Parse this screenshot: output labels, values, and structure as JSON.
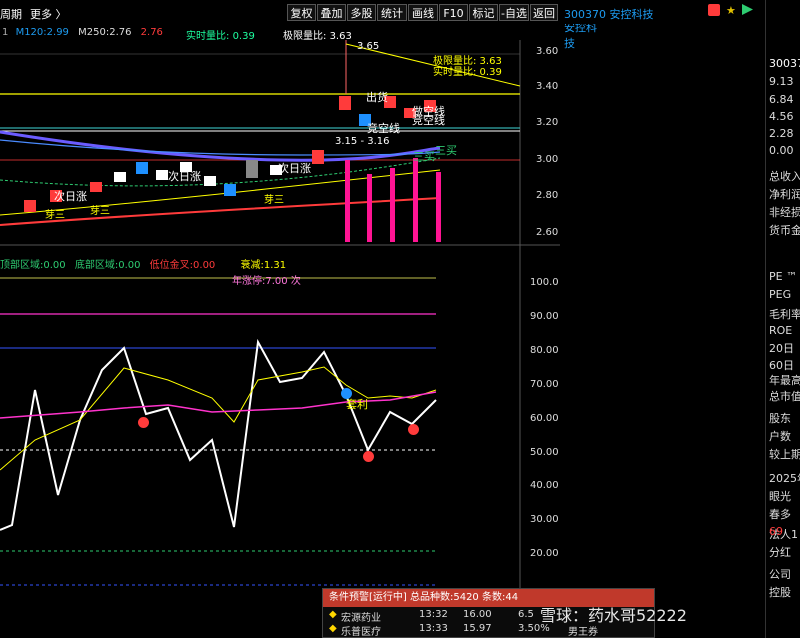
{
  "toolbar": {
    "period": "周期",
    "more": "更多 〉",
    "buttons": [
      "复权",
      "叠加",
      "多股",
      "统计",
      "画线",
      "F10",
      "标记",
      "-自选",
      "返回"
    ]
  },
  "stock": {
    "code_name": "300370 安控科技",
    "code_short": "30037"
  },
  "ma_line": {
    "m120_label": "M120:",
    "m120": "2.99",
    "m250_label": "M250:",
    "m250": "2.76",
    "extra": "2.76",
    "realtime_label": "实时量比:",
    "realtime": "0.39",
    "limit_label": "极限量比:",
    "limit": "3.63",
    "lead": "1"
  },
  "upper_axis": [
    "3.60",
    "3.40",
    "3.20",
    "3.00",
    "2.80",
    "2.60"
  ],
  "lower_axis": [
    "100.0",
    "90.00",
    "80.00",
    "70.00",
    "60.00",
    "50.00",
    "40.00",
    "30.00",
    "20.00"
  ],
  "annotations": {
    "high": "3.65",
    "range": "3.15 - 3.16",
    "limit_box": "极限量比: 3.63",
    "realtime_box": "实时量比: 0.39",
    "sell1": "出货",
    "sell2": "做空线",
    "sell3": "竞空线",
    "sell4": "竞空线",
    "next_day1": "次日涨",
    "next_day2": "次日涨",
    "next_day3": "次日涨",
    "buy1": "三买",
    "buy2": "三买",
    "bud1": "芽三",
    "bud2": "芽三",
    "bud3": "芽三",
    "warn_lbl": "衰减",
    "profit": "套利"
  },
  "lower_info": {
    "top_zone_label": "顶部区域:",
    "top_zone": "0.00",
    "bottom_zone_label": "底部区域:",
    "bottom_zone": "0.00",
    "golden_label": "低位金叉:",
    "golden": "0.00",
    "decay_label": "衰减:",
    "decay": "1.31",
    "limitup_label": "年涨停:",
    "limitup": "7.00 次"
  },
  "right_panel": {
    "price_list": [
      "9.13",
      "6.84",
      "4.56",
      "2.28",
      "0.00"
    ],
    "items": [
      "总收入",
      "净利润",
      "非经损",
      "货币金",
      "PE ™",
      "PEG",
      "毛利率",
      "ROE",
      "20日",
      "60日",
      "年最高",
      "总市值",
      "股东",
      "户数",
      "较上期",
      "2025年",
      "眼光",
      "春多",
      "法人1",
      "分红",
      "公司",
      "控股"
    ],
    "pct": "69"
  },
  "warning": {
    "title": "条件预警[运行中] 总品种数:5420 条数:44",
    "rows": [
      {
        "name": "宏源药业",
        "time": "13:32",
        "price": "16.00",
        "pct": "6.5",
        "tag": ""
      },
      {
        "name": "乐普医疗",
        "time": "13:33",
        "price": "15.97",
        "pct": "3.50%",
        "tag": "男王券"
      }
    ]
  },
  "watermark": "雪球：药水哥52222",
  "colors": {
    "up": "#ff3b3b",
    "down": "#1e90ff",
    "yellow": "#ffff00",
    "magenta": "#ff1493"
  }
}
